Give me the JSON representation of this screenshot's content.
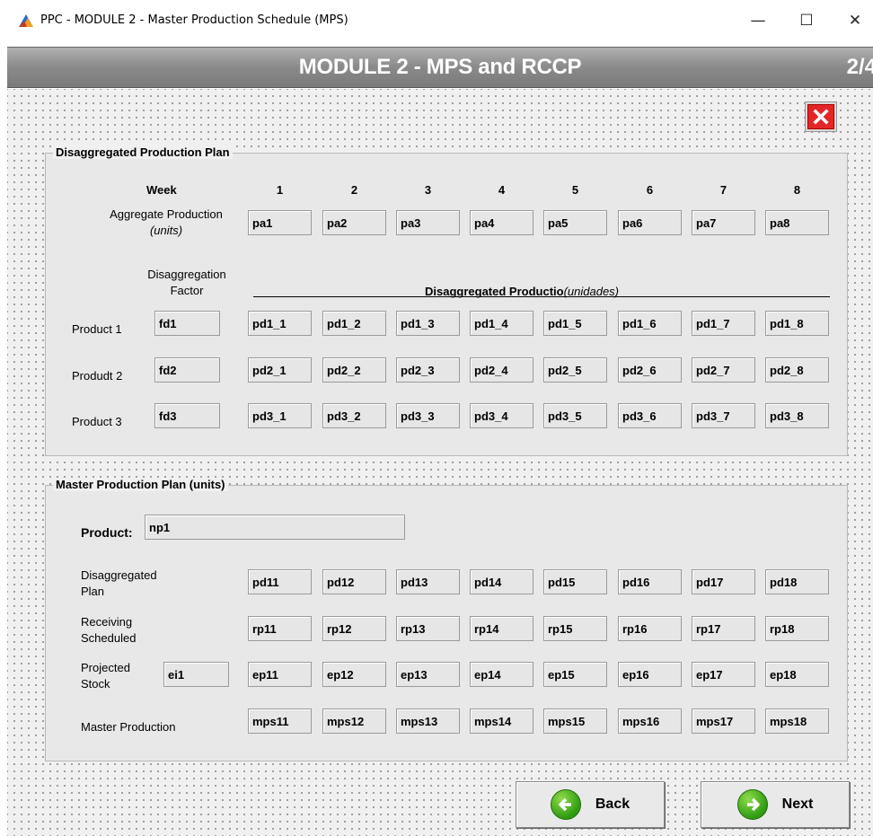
{
  "window": {
    "title": "PPC - MODULE 2 - Master Production Schedule (MPS)",
    "minimize": "—",
    "maximize": "☐",
    "close": "✕"
  },
  "header": {
    "title": "MODULE 2 - MPS and RCCP",
    "page": "2/4"
  },
  "icons": {
    "app": "app-icon",
    "close": "close-icon",
    "back": "arrow-left-icon",
    "next": "arrow-right-icon"
  },
  "colors": {
    "close_red": "#e32626",
    "arrow_green": "#2f9a12",
    "header_gray": "#8a8a8a"
  },
  "disaggregated": {
    "title": "Disaggregated Production Plan",
    "week_label": "Week",
    "weeks": [
      "1",
      "2",
      "3",
      "4",
      "5",
      "6",
      "7",
      "8"
    ],
    "aggregate_label": "Aggregate Production",
    "aggregate_units": "(units)",
    "aggregate": [
      "pa1",
      "pa2",
      "pa3",
      "pa4",
      "pa5",
      "pa6",
      "pa7",
      "pa8"
    ],
    "factor_label_1": "Disaggregation",
    "factor_label_2": "Factor",
    "section_label": "Disaggregated Productio",
    "section_units": "(unidades)",
    "products": [
      {
        "label": "Product 1",
        "factor": "fd1",
        "values": [
          "pd1_1",
          "pd1_2",
          "pd1_3",
          "pd1_4",
          "pd1_5",
          "pd1_6",
          "pd1_7",
          "pd1_8"
        ]
      },
      {
        "label": "Produdt 2",
        "factor": "fd2",
        "values": [
          "pd2_1",
          "pd2_2",
          "pd2_3",
          "pd2_4",
          "pd2_5",
          "pd2_6",
          "pd2_7",
          "pd2_8"
        ]
      },
      {
        "label": "Product 3",
        "factor": "fd3",
        "values": [
          "pd3_1",
          "pd3_2",
          "pd3_3",
          "pd3_4",
          "pd3_5",
          "pd3_6",
          "pd3_7",
          "pd3_8"
        ]
      }
    ]
  },
  "master": {
    "title": "Master Production Plan (units)",
    "product_label": "Product:",
    "product_value": "np1",
    "rows": [
      {
        "label1": "Disaggregated",
        "label2": "Plan",
        "values": [
          "pd11",
          "pd12",
          "pd13",
          "pd14",
          "pd15",
          "pd16",
          "pd17",
          "pd18"
        ]
      },
      {
        "label1": "Receiving",
        "label2": "Scheduled",
        "values": [
          "rp11",
          "rp12",
          "rp13",
          "rp14",
          "rp15",
          "rp16",
          "rp17",
          "rp18"
        ]
      },
      {
        "label1": "Projected",
        "label2": "Stock",
        "initial": "ei1",
        "values": [
          "ep11",
          "ep12",
          "ep13",
          "ep14",
          "ep15",
          "ep16",
          "ep17",
          "ep18"
        ]
      },
      {
        "label1": "Master Production",
        "label2": "",
        "values": [
          "mps11",
          "mps12",
          "mps13",
          "mps14",
          "mps15",
          "mps16",
          "mps17",
          "mps18"
        ]
      }
    ]
  },
  "buttons": {
    "back": "Back",
    "next": "Next"
  }
}
